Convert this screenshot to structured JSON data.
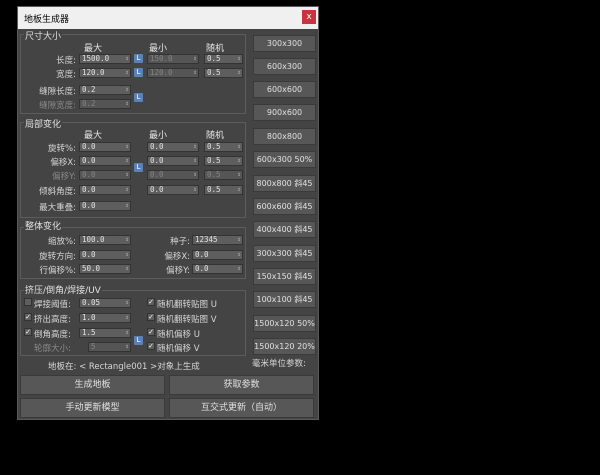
{
  "window": {
    "title": "地板生成器",
    "close": "x"
  },
  "size": {
    "title": "尺寸大小",
    "hdr_max": "最大",
    "hdr_min": "最小",
    "hdr_rand": "随机",
    "length_label": "长度:",
    "length_max": "1500.0",
    "length_min": "150.0",
    "length_rand": "0.5",
    "width_label": "宽度:",
    "width_max": "120.0",
    "width_min": "120.0",
    "width_rand": "0.5",
    "gap_len_label": "缝隙长度:",
    "gap_len": "0.2",
    "gap_wid_label": "缝隙宽度:",
    "gap_wid": "0.2"
  },
  "local": {
    "title": "局部变化",
    "hdr_max": "最大",
    "hdr_min": "最小",
    "hdr_rand": "随机",
    "rot_label": "旋转%:",
    "rot_max": "0.0",
    "rot_min": "0.0",
    "rot_rand": "0.5",
    "offx_label": "偏移X:",
    "offx_max": "0.0",
    "offx_min": "0.0",
    "offx_rand": "0.5",
    "offy_label": "偏移Y:",
    "offy_max": "0.0",
    "offy_min": "0.0",
    "offy_rand": "0.5",
    "tilt_label": "倾斜角度:",
    "tilt_max": "0.0",
    "tilt_min": "0.0",
    "tilt_rand": "0.5",
    "overlap_label": "最大重叠:",
    "overlap": "0.0"
  },
  "global": {
    "title": "整体变化",
    "scale_label": "缩放%:",
    "scale": "100.0",
    "seed_label": "种子:",
    "seed": "12345",
    "rotdir_label": "旋转方向:",
    "rotdir": "0.0",
    "offx_label": "偏移X:",
    "offx": "0.0",
    "rowoff_label": "行偏移%:",
    "rowoff": "50.0",
    "offy_label": "偏移Y:",
    "offy": "0.0"
  },
  "extrude": {
    "title": "挤压/倒角/焊接/UV",
    "weld_label": "焊接阈值:",
    "weld": "0.05",
    "extrude_label": "挤出高度:",
    "extrude": "1.0",
    "bevel_label": "倒角高度:",
    "bevel": "1.5",
    "outline_label": "轮廓大小:",
    "outline": "5",
    "flip_u": "随机翻转贴图 U",
    "flip_v": "随机翻转贴图 V",
    "off_u": "随机偏移 U",
    "off_v": "随机偏移 V"
  },
  "target": {
    "label": "地板在: < Rectangle001 >对象上生成"
  },
  "unit_label": "毫米单位参数:",
  "buttons": {
    "generate": "生成地板",
    "get_params": "获取参数",
    "manual_update": "手动更新模型",
    "interactive_update": "互交式更新（自动）"
  },
  "presets": [
    "300x300",
    "600x300",
    "600x600",
    "900x600",
    "800x800",
    "600x300 50%",
    "800x800 斜45",
    "600x600 斜45",
    "400x400 斜45",
    "300x300 斜45",
    "150x150 斜45",
    "100x100 斜45",
    "1500x120 50%",
    "1500x120 20%"
  ],
  "colors": {
    "background": "#000000",
    "panel": "#444444",
    "lock": "#5b82b7",
    "close": "#c8343e"
  }
}
